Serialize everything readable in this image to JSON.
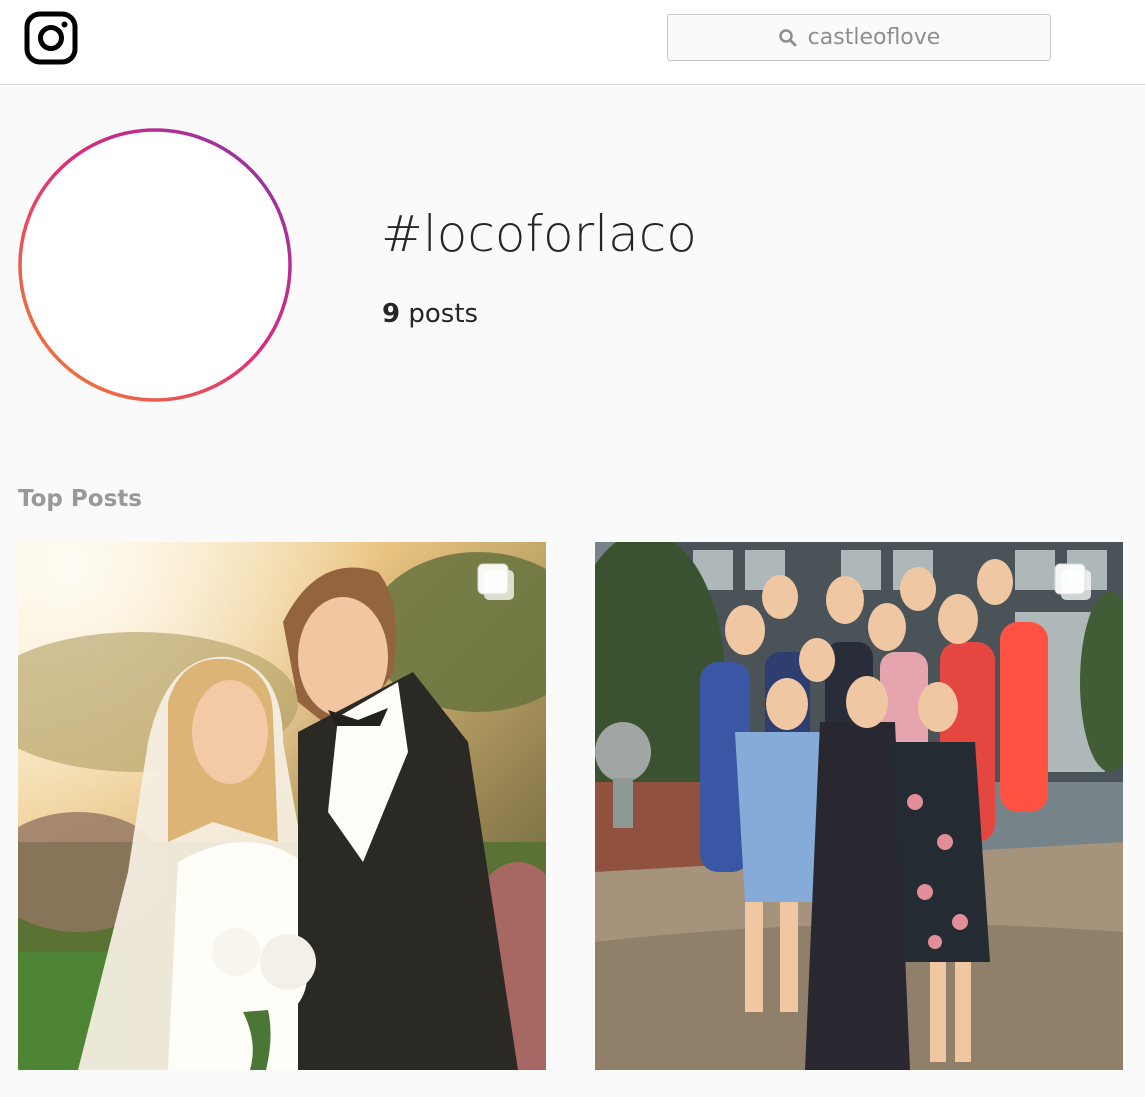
{
  "header": {
    "logo_icon": "instagram-icon",
    "search": {
      "icon": "search-icon",
      "value": "castleoflove"
    }
  },
  "hashtag": {
    "avatar_icon": "hashtag-icon",
    "title": "#locoforlaco",
    "post_count": "9",
    "post_label": "posts"
  },
  "top_posts": {
    "title": "Top Posts",
    "posts": [
      {
        "description_icon": "multiple-photos-icon",
        "subject": "bride-and-groom-photo"
      },
      {
        "description_icon": "multiple-photos-icon",
        "subject": "group-of-women-photo"
      }
    ]
  },
  "colors": {
    "gradient_start": "#f58529",
    "gradient_mid": "#dd2a7b",
    "gradient_end": "#8134af",
    "muted_text": "#999999"
  }
}
